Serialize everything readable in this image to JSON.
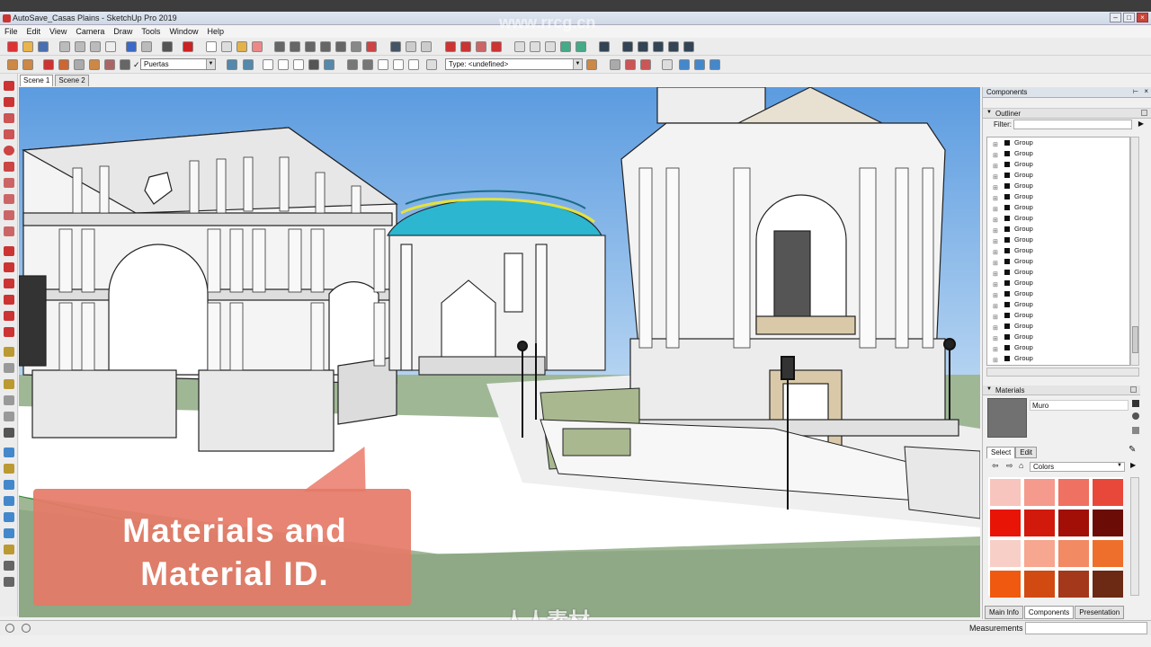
{
  "window": {
    "title": "AutoSave_Casas Plains - SketchUp Pro 2019"
  },
  "menu": [
    "File",
    "Edit",
    "View",
    "Camera",
    "Draw",
    "Tools",
    "Window",
    "Help"
  ],
  "toolbar": {
    "layer_value": "Puertas",
    "type_value": "Type: <undefined>"
  },
  "scene_tabs": [
    "Scene 1",
    "Scene 2"
  ],
  "callout": {
    "line1": "Materials and",
    "line2": "Material ID."
  },
  "watermark": {
    "top": "www.rrcg.cn",
    "bottom": "人人素材"
  },
  "panel": {
    "tray_title": "Components",
    "outliner": {
      "title": "Outliner",
      "filter_label": "Filter:",
      "items": [
        "Group",
        "Group",
        "Group",
        "Group",
        "Group",
        "Group",
        "Group",
        "Group",
        "Group",
        "Group",
        "Group",
        "Group",
        "Group",
        "Group",
        "Group",
        "Group",
        "Group",
        "Group",
        "Group",
        "Group",
        "Group"
      ]
    },
    "materials": {
      "title": "Materials",
      "current": "Muro",
      "tabs": [
        "Select",
        "Edit"
      ],
      "library": "Colors",
      "swatches": [
        "#f7c5bd",
        "#f59a8c",
        "#ef7161",
        "#e8483a",
        "#e81405",
        "#d11a0b",
        "#a10f06",
        "#6b0c06",
        "#f8cfc6",
        "#f7a68f",
        "#f28a64",
        "#ee6f2c",
        "#ef5a10",
        "#d14a12",
        "#a3391a",
        "#6c2a14"
      ]
    },
    "bottom_tabs": [
      "Main Info",
      "Components",
      "Presentation"
    ]
  },
  "status": {
    "measurements_label": "Measurements"
  }
}
